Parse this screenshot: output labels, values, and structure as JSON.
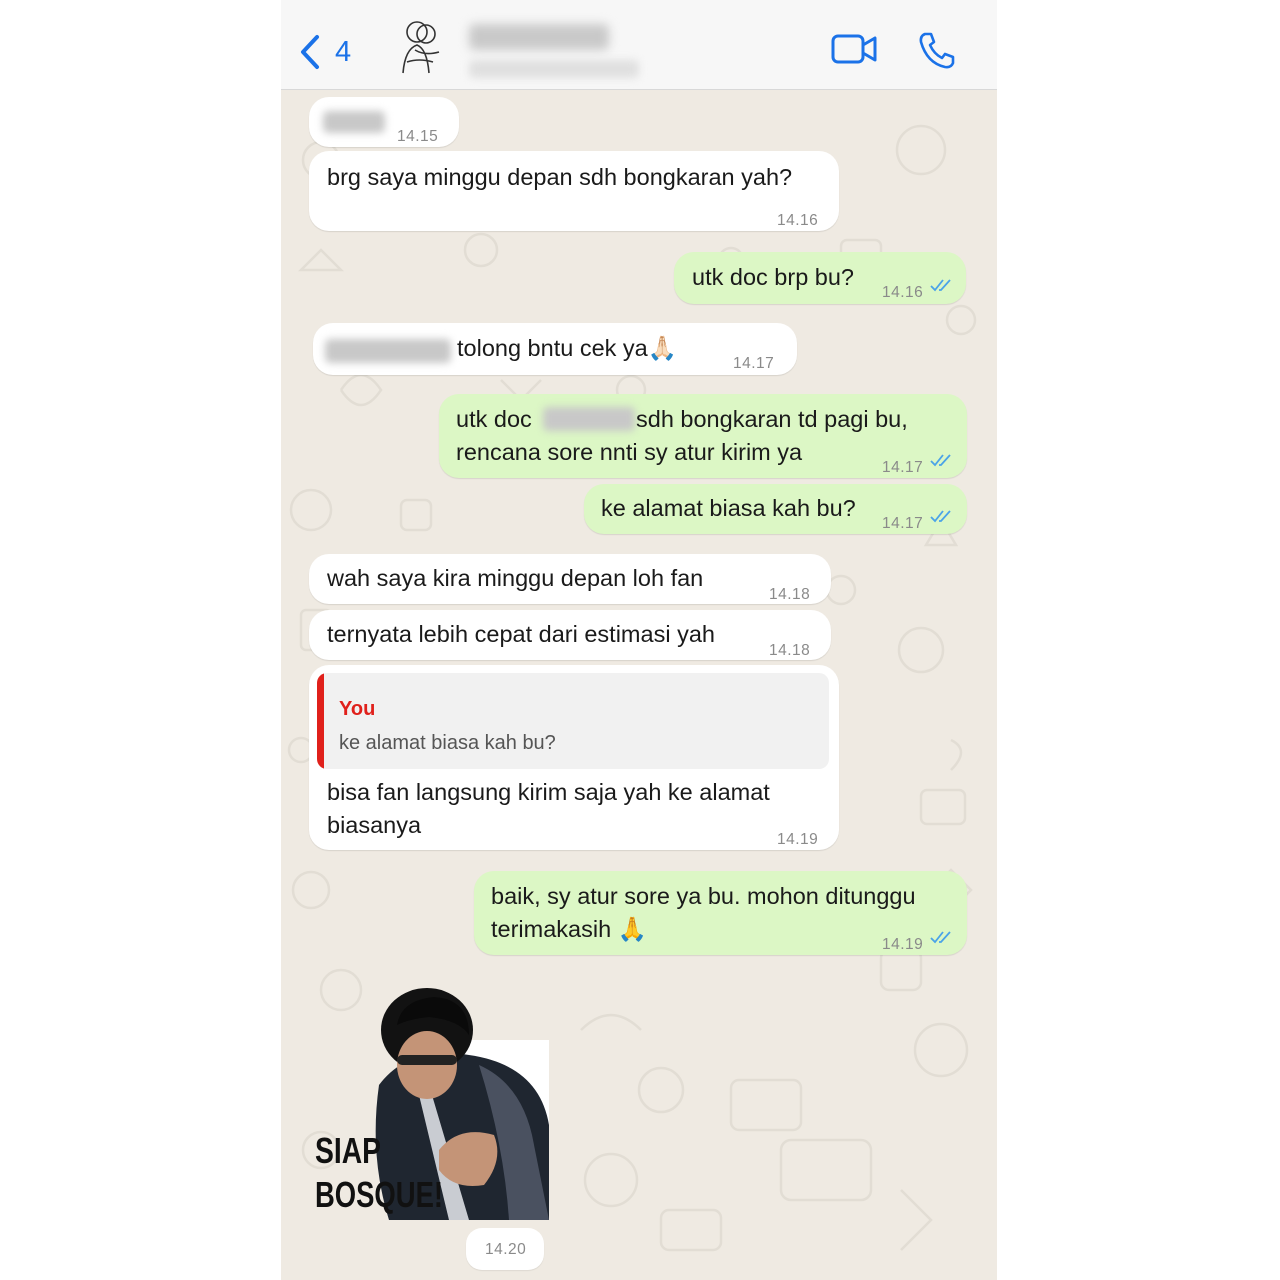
{
  "header": {
    "back_count": "4",
    "icons": {
      "back": "chevron-left-icon",
      "video": "video-call-icon",
      "call": "phone-icon"
    }
  },
  "colors": {
    "accent": "#1b72e8",
    "outgoing": "#dcf7c5",
    "incoming": "#ffffff",
    "quote_bar": "#e0201b",
    "wallpaper": "#efeae2"
  },
  "messages": [
    {
      "dir": "in",
      "text": "",
      "time": "14.15"
    },
    {
      "dir": "in",
      "text": "brg saya minggu depan sdh bongkaran yah?",
      "time": "14.16"
    },
    {
      "dir": "out",
      "text": "utk doc brp bu?",
      "time": "14.16"
    },
    {
      "dir": "in",
      "text": "tolong bntu cek ya🙏🏻",
      "time": "14.17"
    },
    {
      "dir": "out",
      "text_a": "utk doc",
      "text_b": "sdh bongkaran td pagi bu,",
      "text_c": "rencana sore nnti sy atur kirim ya",
      "time": "14.17"
    },
    {
      "dir": "out",
      "text": "ke alamat biasa kah bu?",
      "time": "14.17"
    },
    {
      "dir": "in",
      "text": "wah saya kira minggu depan loh fan",
      "time": "14.18"
    },
    {
      "dir": "in",
      "text": "ternyata lebih cepat dari estimasi yah",
      "time": "14.18"
    },
    {
      "dir": "in",
      "quote_author": "You",
      "quote_text": "ke alamat biasa kah bu?",
      "line1": "bisa fan langsung kirim saja yah ke alamat",
      "line2": "biasanya",
      "time": "14.19"
    },
    {
      "dir": "out",
      "line1": "baik, sy atur sore ya bu. mohon ditunggu",
      "line2": "terimakasih 🙏",
      "time": "14.19"
    }
  ],
  "sticker": {
    "line1": "SIAP",
    "line2": "BOSQUE!",
    "time": "14.20"
  }
}
